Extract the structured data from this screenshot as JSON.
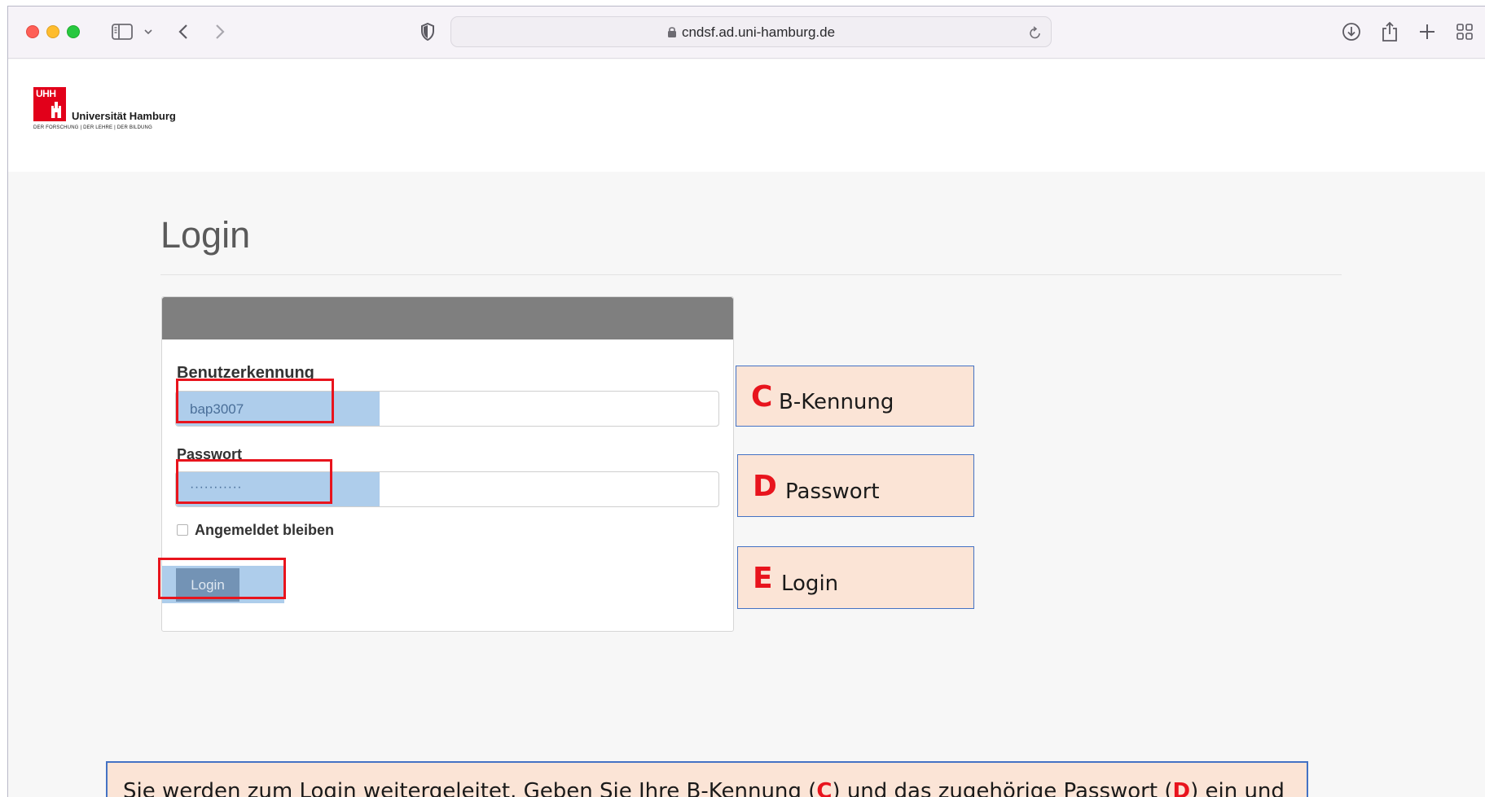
{
  "browser": {
    "url": "cndsf.ad.uni-hamburg.de"
  },
  "site": {
    "logo_mark": "UHH",
    "university_name": "Universität Hamburg",
    "tagline": "DER FORSCHUNG | DER LEHRE | DER BILDUNG"
  },
  "login": {
    "title": "Login",
    "username_label": "Benutzerkennung",
    "username_value": "bap3007",
    "password_label": "Passwort",
    "password_value": "···········",
    "remember_label": "Angemeldet bleiben",
    "submit_label": "Login"
  },
  "callouts": [
    {
      "letter": "C",
      "text": "B-Kennung"
    },
    {
      "letter": "D",
      "text": "Passwort"
    },
    {
      "letter": "E",
      "text": "Login"
    }
  ],
  "note": {
    "part1": "Sie werden zum Login weitergeleitet. Geben Sie Ihre B-Kennung (",
    "letter1": "C",
    "part2": ") und das zugehörige Passwort (",
    "letter2": "D",
    "part3": ") ein und"
  },
  "colors": {
    "highlight": "#e8141d",
    "callout_fill": "#fbe4d6",
    "callout_border": "#4472c4",
    "uhh_red": "#e2001a",
    "autofill": "#aecdeb"
  },
  "icons": {
    "sidebar": "sidebar-icon",
    "back": "chevron-left-icon",
    "forward": "chevron-right-icon",
    "privacy": "shield-icon",
    "lock": "lock-icon",
    "reload": "reload-icon",
    "download": "download-icon",
    "share": "share-icon",
    "new_tab": "plus-icon",
    "tab_overview": "grid-icon"
  }
}
